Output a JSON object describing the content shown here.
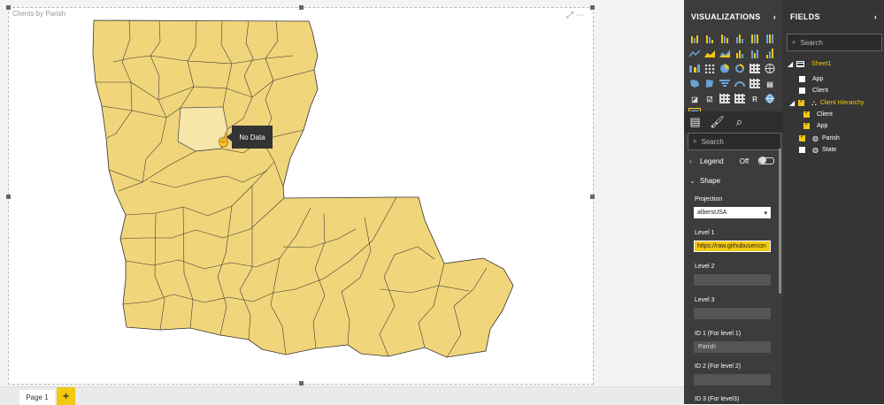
{
  "report": {
    "visual_title": "Clients by Parish",
    "tooltip": "No Data",
    "page_tab": "Page 1",
    "add_page": "+"
  },
  "visualizations": {
    "title": "VISUALIZATIONS",
    "search_placeholder": "Search",
    "legend": {
      "label": "Legend",
      "state": "Off"
    },
    "shape": {
      "label": "Shape"
    },
    "projection": {
      "label": "Projection",
      "value": "albersUSA"
    },
    "level1": {
      "label": "Level 1",
      "value": "https://raw.githubusercon"
    },
    "level2": {
      "label": "Level 2",
      "value": ""
    },
    "level3": {
      "label": "Level 3",
      "value": ""
    },
    "id1": {
      "label": "ID 1 (For level 1)",
      "value": "Parish"
    },
    "id2": {
      "label": "ID 2 (For level 2)",
      "value": ""
    },
    "id3": {
      "label": "ID 3 (For level3)"
    }
  },
  "fields": {
    "title": "FIELDS",
    "search_placeholder": "Search",
    "table_name": "Sheet1",
    "items": [
      {
        "label": "App",
        "checked": false
      },
      {
        "label": "Client",
        "checked": false
      },
      {
        "label": "Client Hierarchy",
        "checked": true
      },
      {
        "label": "Client",
        "checked": true
      },
      {
        "label": "App",
        "checked": true
      },
      {
        "label": "Parish",
        "checked": true
      },
      {
        "label": "State",
        "checked": false
      }
    ]
  },
  "icons": [
    "chevron-right-icon",
    "search-icon",
    "fields-icon",
    "format-icon",
    "analytics-icon",
    "cursor-icon",
    "ellipsis-icon",
    "expand-icon",
    "map-icon"
  ],
  "colors": {
    "map_fill": "#f1d57a",
    "highlight_fill": "#f8e6a9",
    "accent": "#f2c811",
    "pane_bg": "#3c3c3c",
    "fields_bg": "#353535"
  }
}
